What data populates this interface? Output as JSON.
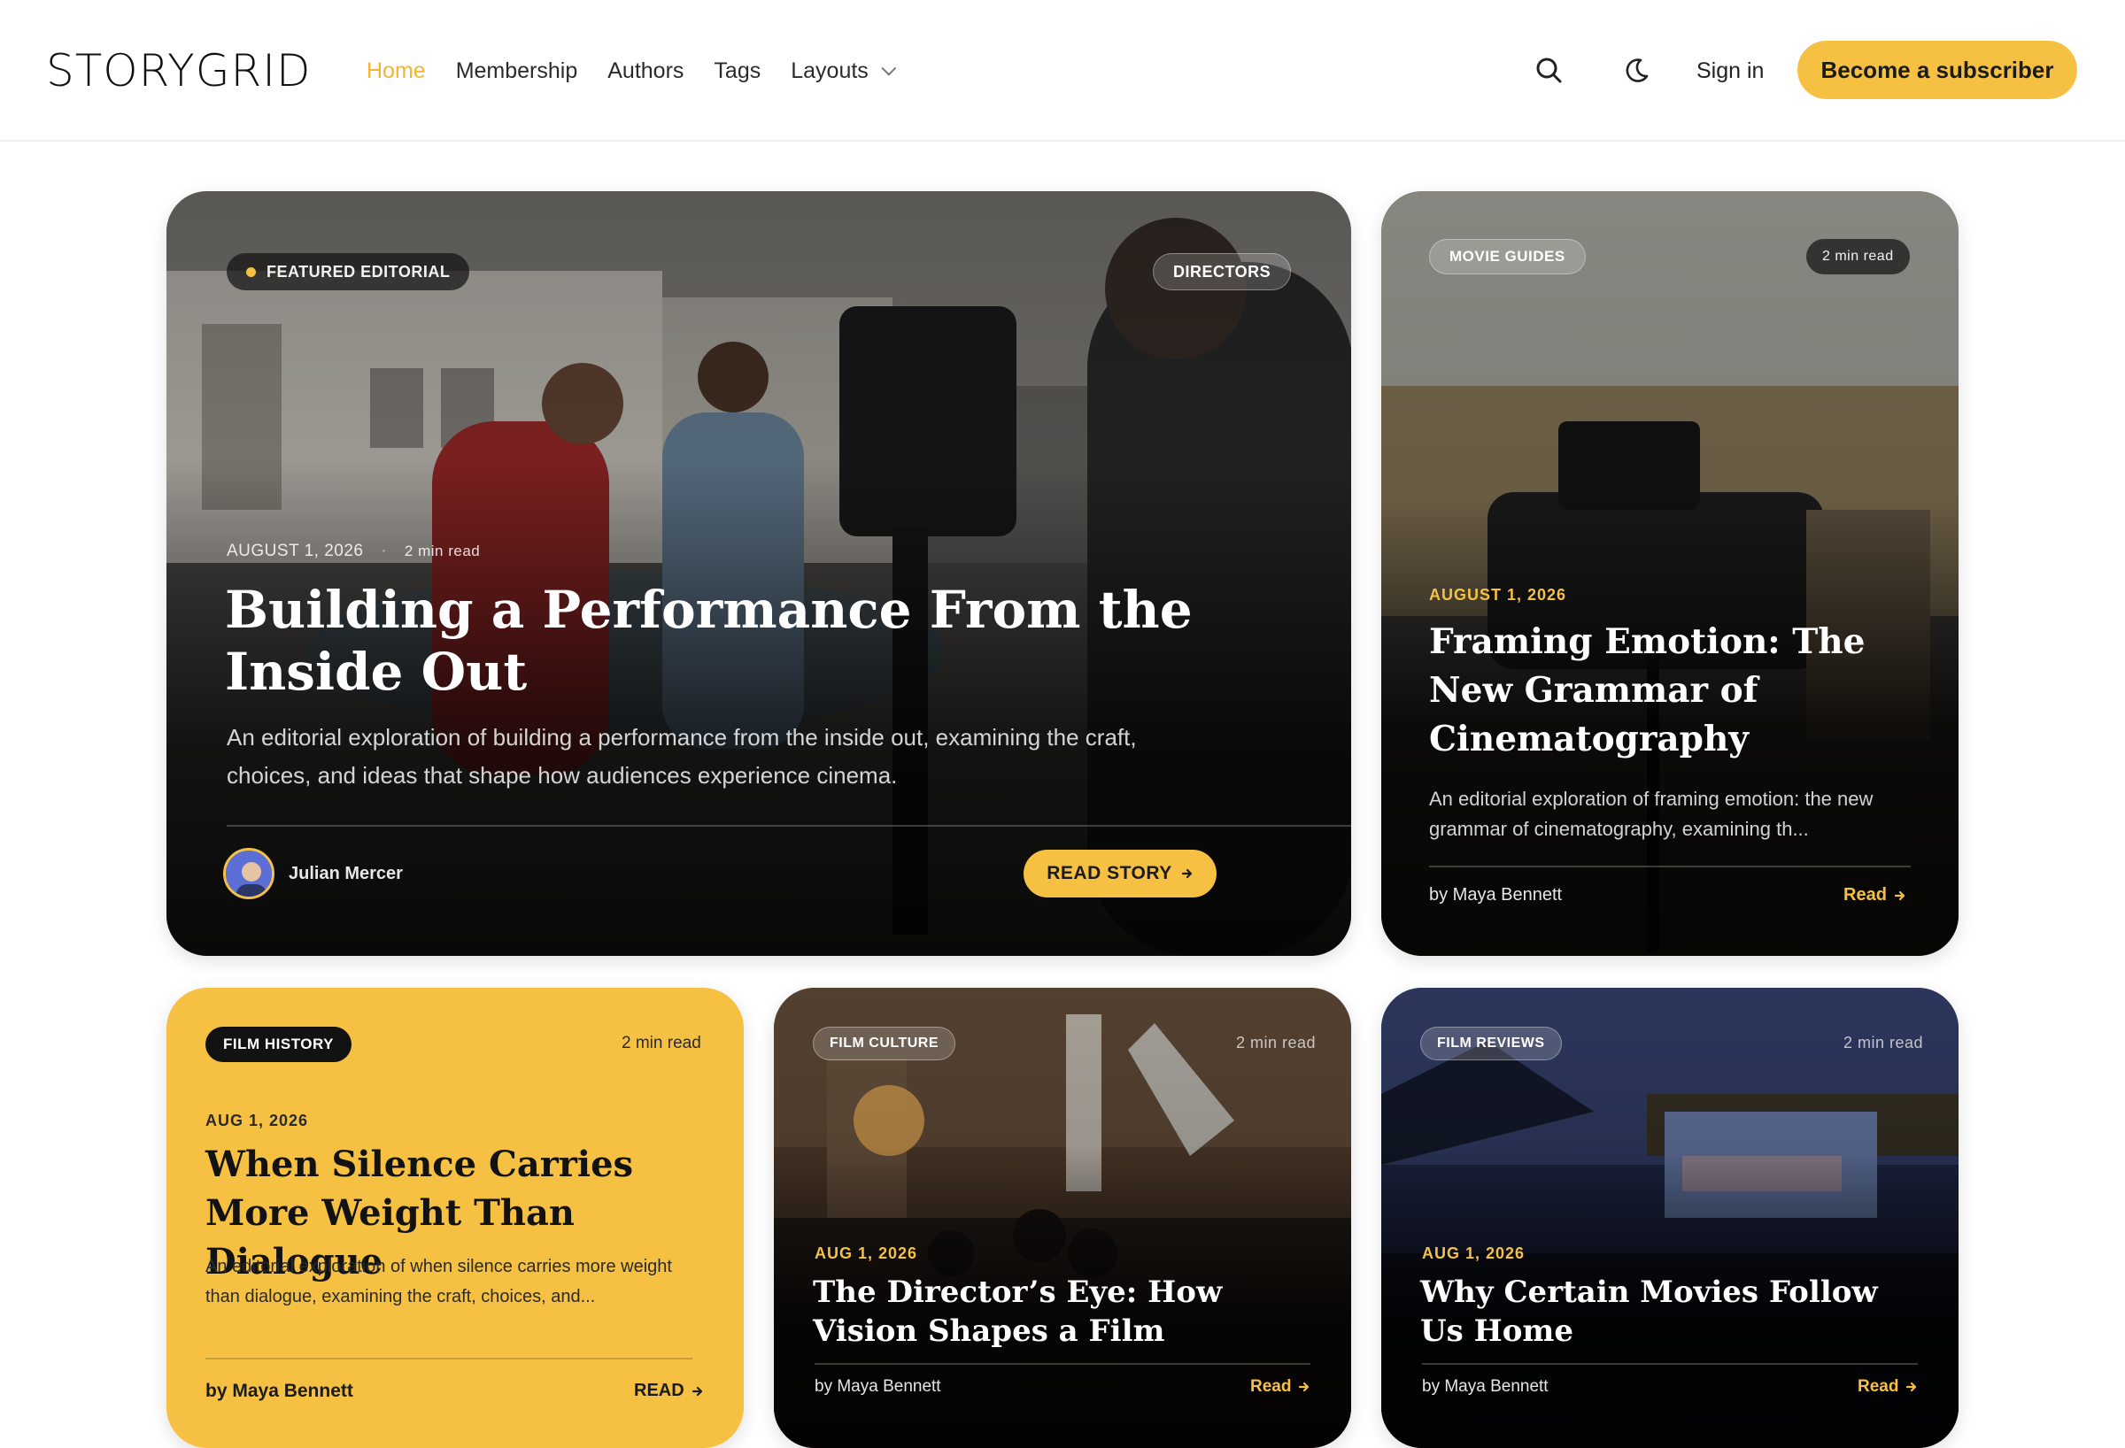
{
  "brand": {
    "logo_text": "STORYGRID",
    "accent": "#f6c142"
  },
  "nav": {
    "items": [
      {
        "label": "Home",
        "active": true
      },
      {
        "label": "Membership"
      },
      {
        "label": "Authors"
      },
      {
        "label": "Tags"
      },
      {
        "label": "Layouts",
        "has_dropdown": true
      }
    ]
  },
  "header_actions": {
    "search_icon": "search-icon",
    "theme_icon": "moon-icon",
    "signin_label": "Sign in",
    "subscribe_label": "Become a subscriber"
  },
  "featured": {
    "badge": "FEATURED EDITORIAL",
    "tag": "DIRECTORS",
    "date": "AUGUST 1, 2026",
    "read_time": "2 min read",
    "title": "Building a Performance From the Inside Out",
    "excerpt": "An editorial exploration of building a performance from the inside out, examining the craft, choices, and ideas that shape how audiences experience cinema.",
    "author": "Julian Mercer",
    "cta": "READ STORY"
  },
  "side_card": {
    "tag": "MOVIE GUIDES",
    "read_time": "2 min read",
    "date": "AUGUST 1, 2026",
    "title": "Framing Emotion: The New Grammar of Cinematography",
    "excerpt": "An editorial exploration of framing emotion: the new grammar of cinematography, examining th...",
    "byline": "by Maya Bennett",
    "cta": "Read"
  },
  "cards": [
    {
      "tag": "FILM HISTORY",
      "read_time": "2 min read",
      "date": "AUG 1, 2026",
      "title": "When Silence Carries More Weight Than Dialogue",
      "excerpt": "An editorial exploration of when silence carries more weight than dialogue, examining the craft, choices, and...",
      "byline": "by Maya Bennett",
      "cta": "READ"
    },
    {
      "tag": "FILM CULTURE",
      "read_time": "2 min read",
      "date": "AUG 1, 2026",
      "title": "The Director’s Eye: How Vision Shapes a Film",
      "byline": "by Maya Bennett",
      "cta": "Read"
    },
    {
      "tag": "FILM REVIEWS",
      "read_time": "2 min read",
      "date": "AUG 1, 2026",
      "title": "Why Certain Movies Follow Us Home",
      "byline": "by Maya Bennett",
      "cta": "Read"
    }
  ]
}
